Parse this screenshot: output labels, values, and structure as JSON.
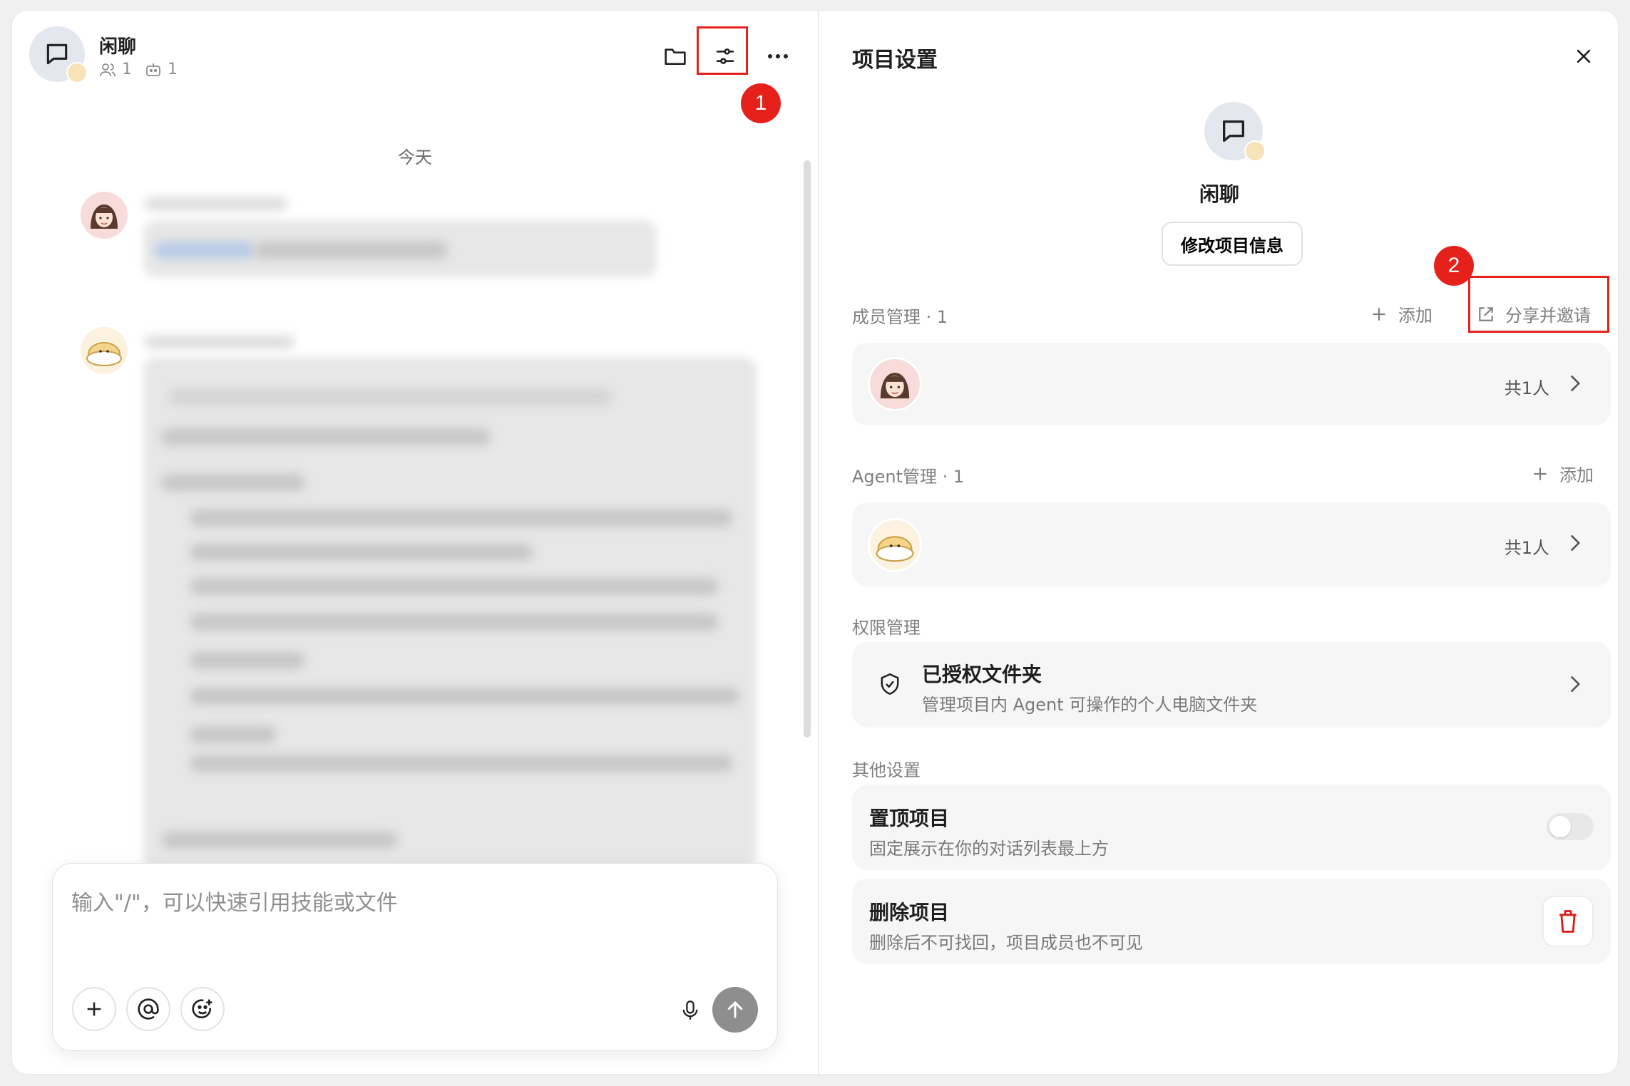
{
  "chat": {
    "title": "闲聊",
    "member_count": "1",
    "agent_count": "1",
    "date_separator": "今天"
  },
  "header_icons": [
    "folder-icon",
    "settings-sliders-icon",
    "more-icon"
  ],
  "composer": {
    "placeholder": "输入\"/\"，可以快速引用技能或文件",
    "buttons": [
      "plus-icon",
      "at-icon",
      "emoji-icon",
      "mic-icon",
      "send-arrow-icon"
    ]
  },
  "annotations": {
    "step1": "1",
    "step2": "2",
    "highlight_color": "#e6211b"
  },
  "settings": {
    "title": "项目设置",
    "project_name": "闲聊",
    "edit_button": "修改项目信息",
    "members": {
      "label": "成员管理 · 1",
      "add": "添加",
      "share": "分享并邀请",
      "count": "共1人"
    },
    "agents": {
      "label": "Agent管理 · 1",
      "add": "添加",
      "count": "共1人"
    },
    "permissions": {
      "label": "权限管理",
      "folder_title": "已授权文件夹",
      "folder_desc": "管理项目内 Agent 可操作的个人电脑文件夹"
    },
    "other": {
      "label": "其他设置",
      "pin_title": "置顶项目",
      "pin_desc": "固定展示在你的对话列表最上方",
      "pin_enabled": false,
      "delete_title": "删除项目",
      "delete_desc": "删除后不可找回，项目成员也不可见"
    }
  },
  "colors": {
    "accent_red": "#e6211b",
    "trash_red": "#d9201a",
    "send_gray": "#8e8e8e"
  }
}
